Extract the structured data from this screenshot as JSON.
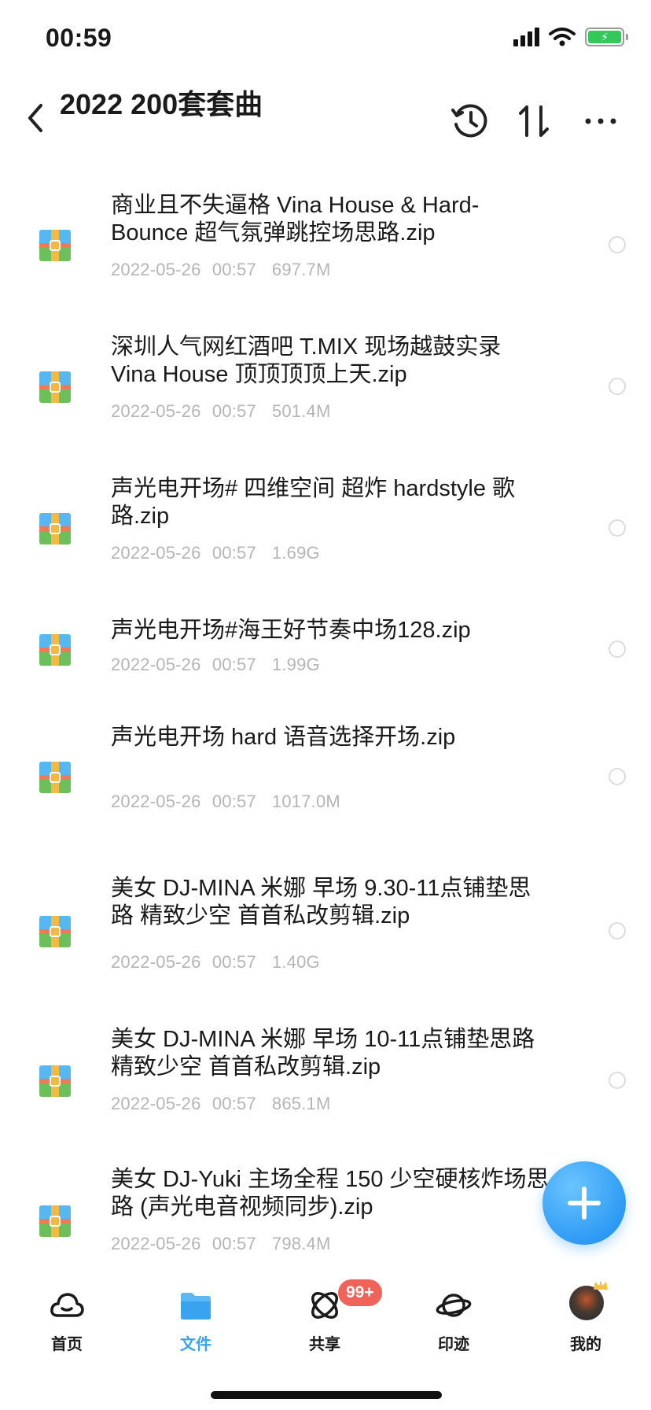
{
  "status_bar": {
    "time": "00:59"
  },
  "header": {
    "title": "2022 200套套曲"
  },
  "files": [
    {
      "name": "商业且不失逼格 Vina House & Hard-Bounce 超气氛弹跳控场思路.zip",
      "date": "2022-05-26 00:57",
      "size": "697.7M"
    },
    {
      "name": "深圳人气网红酒吧 T.MIX 现场越鼓实录 Vina House 顶顶顶顶上天.zip",
      "date": "2022-05-26 00:57",
      "size": "501.4M"
    },
    {
      "name": "声光电开场# 四维空间 超炸 hardstyle 歌路.zip",
      "date": "2022-05-26 00:57",
      "size": "1.69G"
    },
    {
      "name": "声光电开场#海王好节奏中场128.zip",
      "date": "2022-05-26 00:57",
      "size": "1.99G"
    },
    {
      "name": "声光电开场 hard 语音选择开场.zip",
      "date": "2022-05-26 00:57",
      "size": "1017.0M"
    },
    {
      "name": "美女 DJ-MINA 米娜 早场 9.30-11点铺垫思路 精致少空 首首私改剪辑.zip",
      "date": "2022-05-26 00:57",
      "size": "1.40G"
    },
    {
      "name": "美女 DJ-MINA 米娜 早场 10-11点铺垫思路 精致少空 首首私改剪辑.zip",
      "date": "2022-05-26 00:57",
      "size": "865.1M"
    },
    {
      "name": "美女 DJ-Yuki 主场全程 150 少空硬核炸场思路 (声光电音视频同步).zip",
      "date": "2022-05-26 00:57",
      "size": "798.4M"
    }
  ],
  "tabs": [
    {
      "label": "首页",
      "icon": "cloud-icon"
    },
    {
      "label": "文件",
      "icon": "folder-icon"
    },
    {
      "label": "共享",
      "icon": "share-orbit-icon"
    },
    {
      "label": "印迹",
      "icon": "planet-icon"
    },
    {
      "label": "我的",
      "icon": "avatar"
    }
  ],
  "share_badge": "99+",
  "colors": {
    "accent": "#3aa3f0",
    "badge": "#f0635a",
    "meta_text": "#b5b5b5",
    "fab": "#2f9bf5"
  }
}
